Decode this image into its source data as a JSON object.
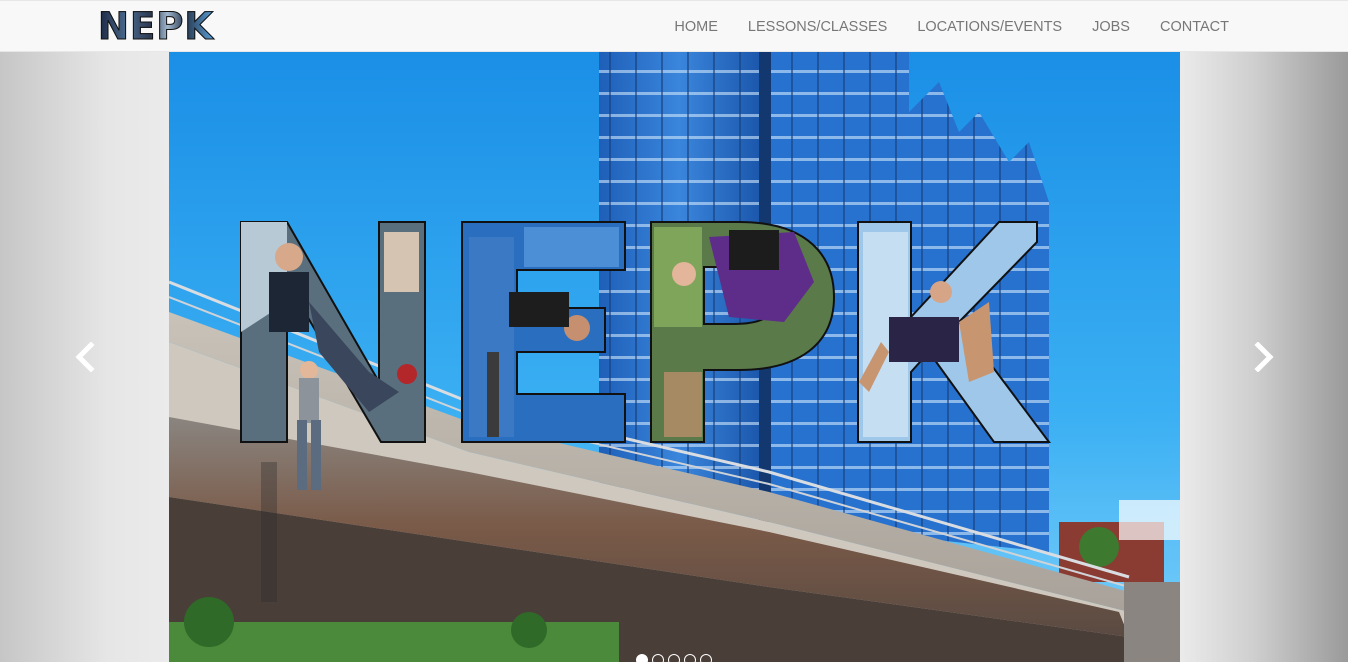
{
  "brand": {
    "logo_text": "NEPK"
  },
  "nav": {
    "items": [
      {
        "label": "HOME"
      },
      {
        "label": "LESSONS/CLASSES"
      },
      {
        "label": "LOCATIONS/EVENTS"
      },
      {
        "label": "JOBS"
      },
      {
        "label": "CONTACT"
      }
    ]
  },
  "carousel": {
    "slide_logo_text": "NEPK",
    "slide_count": 5,
    "active_slide": 1,
    "prev_icon": "chevron-left-icon",
    "next_icon": "chevron-right-icon"
  },
  "colors": {
    "navbar_bg": "#f8f8f8",
    "nav_text": "#777777",
    "sky": "#2fa4f0",
    "building": "#2a6fc9"
  }
}
